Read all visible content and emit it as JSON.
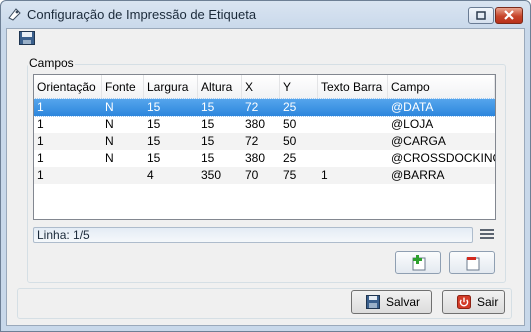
{
  "window": {
    "title": "Configuração de Impressão de Etiqueta"
  },
  "toolbar": {
    "save_icon": "floppy-disk-icon"
  },
  "group": {
    "label": "Campos"
  },
  "table": {
    "columns": [
      "Orientação",
      "Fonte",
      "Largura",
      "Altura",
      "X",
      "Y",
      "Texto Barra",
      "Campo"
    ],
    "rows": [
      [
        "1",
        "N",
        "15",
        "15",
        "72",
        "25",
        "",
        "@DATA"
      ],
      [
        "1",
        "N",
        "15",
        "15",
        "380",
        "50",
        "",
        "@LOJA"
      ],
      [
        "1",
        "N",
        "15",
        "15",
        "72",
        "50",
        "",
        "@CARGA"
      ],
      [
        "1",
        "N",
        "15",
        "15",
        "380",
        "25",
        "",
        "@CROSSDOCKING"
      ],
      [
        "1",
        "",
        "4",
        "350",
        "70",
        "75",
        "1",
        "@BARRA"
      ]
    ],
    "selected_row": 0
  },
  "status": {
    "text": "Linha: 1/5"
  },
  "buttons": {
    "save_label": "Salvar",
    "exit_label": "Sair"
  },
  "colors": {
    "selection": "#3399ff",
    "window_frame": "#c8d8ea",
    "dialog_bg": "#f0f0f0"
  }
}
